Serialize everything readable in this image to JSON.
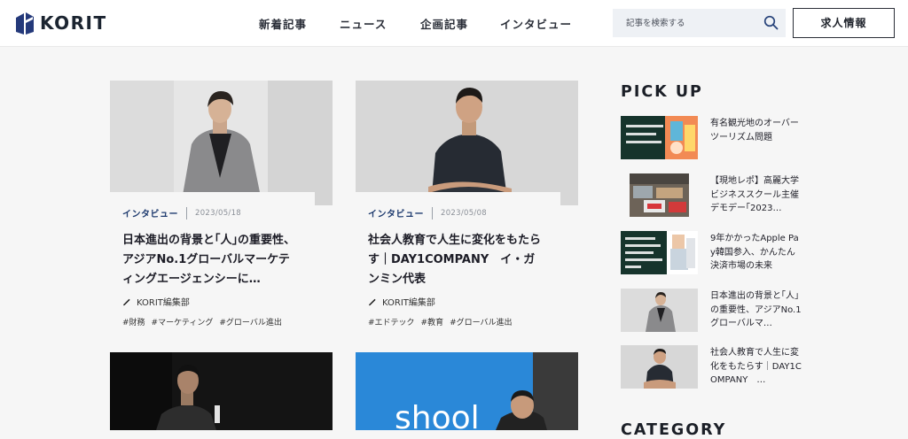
{
  "header": {
    "logo_text": "KORIT",
    "nav": [
      "新着記事",
      "ニュース",
      "企画記事",
      "インタビュー"
    ],
    "search_placeholder": "記事を検索する",
    "jobs_label": "求人情報"
  },
  "articles": [
    {
      "category": "インタビュー",
      "date": "2023/05/18",
      "title": "日本進出の背景と｢人｣の重要性、アジアNo.1グローバルマーケティングエージェンシーに…",
      "author": "KORIT編集部",
      "tags": [
        "#財務",
        "#マーケティング",
        "#グローバル進出"
      ]
    },
    {
      "category": "インタビュー",
      "date": "2023/05/08",
      "title": "社会人教育で人生に変化をもたらす｜DAY1COMPANY　イ・ガンミン代表",
      "author": "KORIT編集部",
      "tags": [
        "#エドテック",
        "#教育",
        "#グローバル進出"
      ]
    }
  ],
  "lower_cards": [
    {
      "sign_text": "shool"
    }
  ],
  "sidebar": {
    "pickup_title": "PICK UP",
    "category_title": "CATEGORY",
    "items": [
      {
        "text": "有名観光地のオーバーツーリズム問題",
        "thumb_text": "有名観光地の\nオーバー\nツーリズム問題"
      },
      {
        "text": "【現地レポ】高麗大学ビジネススクール主催デモデー｢2023…"
      },
      {
        "text": "9年かかったApple Pay韓国参入、かんたん決済市場の未来",
        "thumb_text": "9年かかった\nAPPLE PAY\n韓国参入、\nかんたん決済市場\nの未来"
      },
      {
        "text": "日本進出の背景と｢人｣の重要性、アジアNo.1グローバルマ…"
      },
      {
        "text": "社会人教育で人生に変化をもたらす｜DAY1COMPANY　…"
      }
    ]
  },
  "colors": {
    "accent": "#1d3a6e",
    "background": "#f6f6f6",
    "header_bg": "#ffffff",
    "search_bg": "#eef1f5",
    "pickup_dark": "#16342c"
  },
  "icons": {
    "logo": "korit-logo-mark",
    "search": "search-icon",
    "author": "pen-icon"
  }
}
